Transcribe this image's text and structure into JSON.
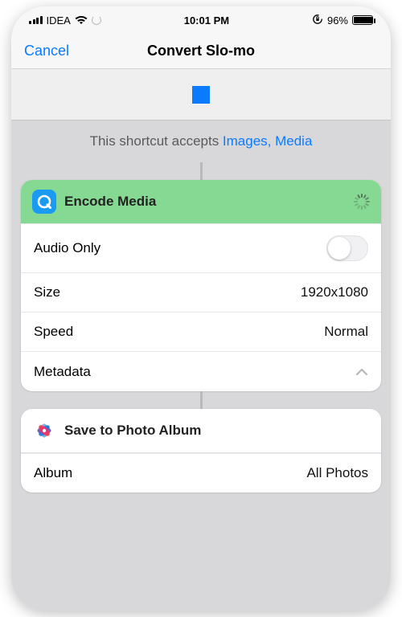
{
  "status": {
    "carrier": "IDEA",
    "time": "10:01 PM",
    "battery_pct": "96%"
  },
  "nav": {
    "cancel": "Cancel",
    "title": "Convert Slo-mo"
  },
  "accepts": {
    "prefix": "This shortcut accepts ",
    "types": "Images, Media"
  },
  "actions": {
    "encode": {
      "icon": "quicktime-icon",
      "title": "Encode Media",
      "rows": {
        "audio_only": {
          "label": "Audio Only",
          "on": false
        },
        "size": {
          "label": "Size",
          "value": "1920x1080"
        },
        "speed": {
          "label": "Speed",
          "value": "Normal"
        },
        "metadata": {
          "label": "Metadata"
        }
      }
    },
    "save": {
      "icon": "photos-icon",
      "title": "Save to Photo Album",
      "rows": {
        "album": {
          "label": "Album",
          "value": "All Photos"
        }
      }
    }
  }
}
